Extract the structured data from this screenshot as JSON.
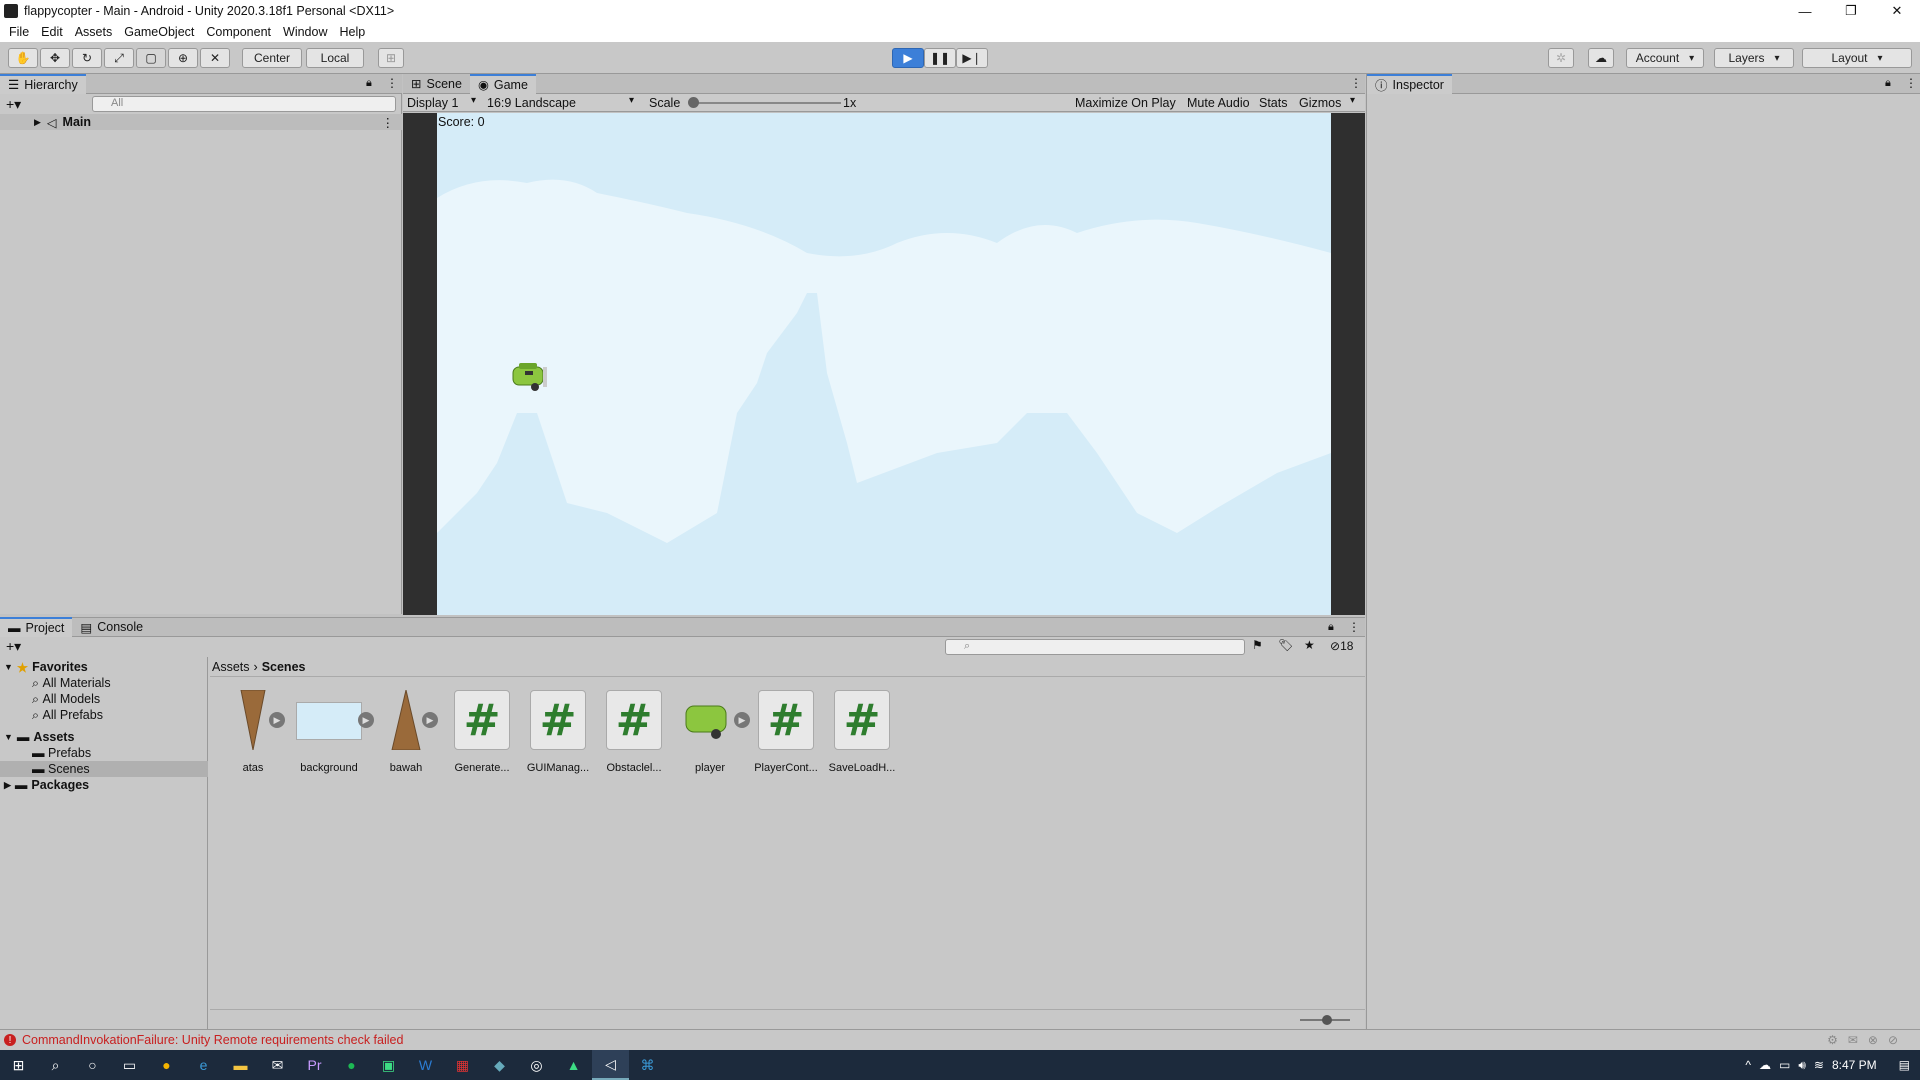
{
  "window": {
    "title": "flappycopter - Main - Android - Unity 2020.3.18f1 Personal <DX11>"
  },
  "menu": [
    "File",
    "Edit",
    "Assets",
    "GameObject",
    "Component",
    "Window",
    "Help"
  ],
  "toolbar": {
    "pivot_center": "Center",
    "pivot_local": "Local",
    "account": "Account",
    "layers": "Layers",
    "layout": "Layout"
  },
  "hierarchy": {
    "tab": "Hierarchy",
    "search_placeholder": "All",
    "scene_item": "Main"
  },
  "view": {
    "tabs": [
      "Scene",
      "Game"
    ],
    "active_tab": "Game",
    "display": "Display 1",
    "aspect": "16:9 Landscape",
    "scale_label": "Scale",
    "scale_value": "1x",
    "maximize": "Maximize On Play",
    "mute": "Mute Audio",
    "stats": "Stats",
    "gizmos": "Gizmos"
  },
  "game": {
    "score_text": "Score: 0"
  },
  "inspector": {
    "tab": "Inspector"
  },
  "project": {
    "tabs": [
      "Project",
      "Console"
    ],
    "hidden_count": "18",
    "favorites_label": "Favorites",
    "favorites": [
      "All Materials",
      "All Models",
      "All Prefabs"
    ],
    "assets_label": "Assets",
    "asset_folders": [
      "Prefabs",
      "Scenes"
    ],
    "packages_label": "Packages",
    "breadcrumb": [
      "Assets",
      "Scenes"
    ],
    "items": [
      "atas",
      "background",
      "bawah",
      "Generate...",
      "GUIManag...",
      "Obstaclel...",
      "player",
      "PlayerCont...",
      "SaveLoadH..."
    ]
  },
  "status": {
    "error_text": "CommandInvokationFailure: Unity Remote requirements check failed"
  },
  "taskbar": {
    "time": "8:47 PM"
  },
  "colors": {
    "accent": "#3c7fd8",
    "sky": "#d4ebf7",
    "error": "#c82020",
    "taskbar": "#1c2a3c"
  }
}
